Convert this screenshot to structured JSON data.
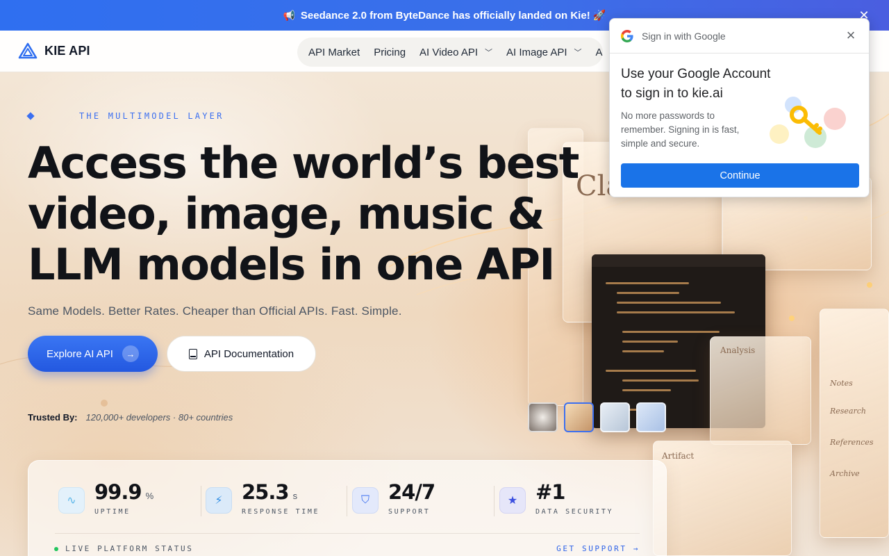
{
  "announcement": {
    "text": "Seedance 2.0 from ByteDance has officially landed on Kie! 🚀",
    "close_glyph": "✕"
  },
  "nav": {
    "brand": "KIE API",
    "links": [
      {
        "label": "API Market",
        "has_menu": false
      },
      {
        "label": "Pricing",
        "has_menu": false
      },
      {
        "label": "AI Video API",
        "has_menu": true
      },
      {
        "label": "AI Image API",
        "has_menu": true
      },
      {
        "label": "A",
        "has_menu": false
      }
    ]
  },
  "hero": {
    "eyebrow": "THE MULTIMODEL LAYER",
    "headline_lines": [
      "Access the world’s best",
      "video, image, music &",
      "LLM models in one API"
    ],
    "subline": "Same Models. Better Rates. Cheaper than Official APIs. Fast. Simple.",
    "primary_cta": "Explore AI API",
    "secondary_cta": "API Documentation",
    "trusted_label": "Trusted By:",
    "trusted_value": "120,000+ developers · 80+ countries"
  },
  "deco": {
    "card_claude": "Claude",
    "card_analysis": "Analysis",
    "card_artifact": "Artifact",
    "tab_notes": "Notes",
    "tab_research": "Research",
    "tab_references": "References",
    "tab_archive": "Archive"
  },
  "stats": {
    "items": [
      {
        "value": "99.9",
        "unit": "%",
        "label": "UPTIME",
        "icon": "pulse-icon",
        "color": "#5bb6e8"
      },
      {
        "value": "25.3",
        "unit": "s",
        "label": "RESPONSE TIME",
        "icon": "lightning-icon",
        "color": "#2f8de4"
      },
      {
        "value": "24/7",
        "unit": "",
        "label": "SUPPORT",
        "icon": "shield-check-icon",
        "color": "#3b6ff0"
      },
      {
        "value": "#1",
        "unit": "",
        "label": "DATA SECURITY",
        "icon": "star-icon",
        "color": "#3b4fe0"
      }
    ],
    "live_label": "LIVE PLATFORM STATUS",
    "support_link": "GET SUPPORT →"
  },
  "google_popup": {
    "header": "Sign in with Google",
    "title": "Use your Google Account to sign in to kie.ai",
    "description": "No more passwords to remember. Signing in is fast, simple and secure.",
    "button": "Continue"
  },
  "colors": {
    "accent": "#3b6ff0",
    "google_blue": "#1a73e8"
  }
}
